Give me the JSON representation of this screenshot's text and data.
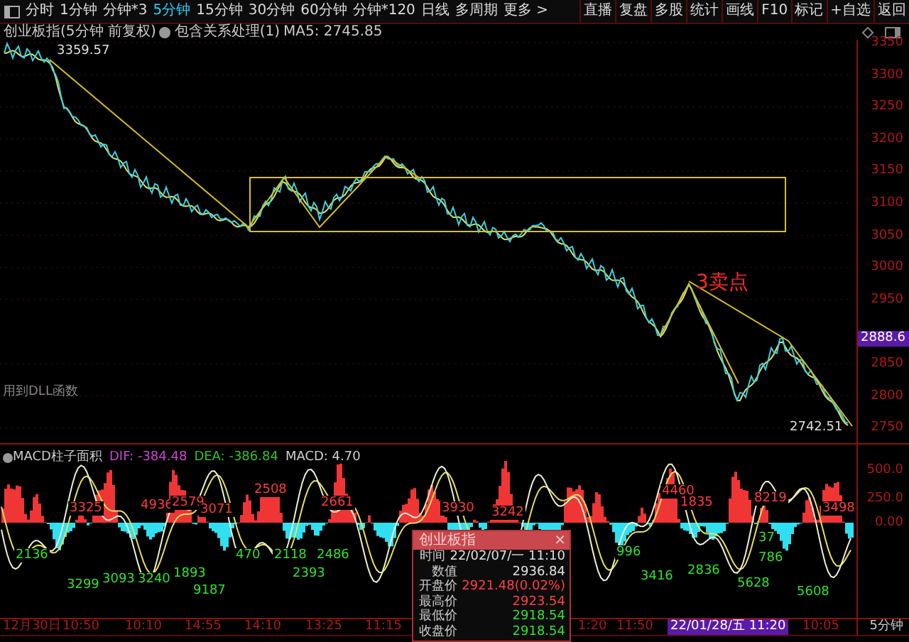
{
  "toolbar": {
    "periods": [
      {
        "label": "分时",
        "selected": false
      },
      {
        "label": "1分钟",
        "selected": false
      },
      {
        "label": "分钟*3",
        "selected": false
      },
      {
        "label": "5分钟",
        "selected": true
      },
      {
        "label": "15分钟",
        "selected": false
      },
      {
        "label": "30分钟",
        "selected": false
      },
      {
        "label": "60分钟",
        "selected": false
      },
      {
        "label": "分钟*120",
        "selected": false
      },
      {
        "label": "日线",
        "selected": false
      },
      {
        "label": "多周期",
        "selected": false
      }
    ],
    "more": "更多 >",
    "actions": [
      "直播",
      "复盘",
      "多股",
      "统计",
      "画线",
      "F10",
      "标记",
      "+自选",
      "返回"
    ]
  },
  "chart_header": {
    "title": "创业板指(5分钟 前复权)",
    "indicator": "包含关系处理(1)",
    "ma": "MA5: 2745.85"
  },
  "price_chart": {
    "high_label": "3359.57",
    "low_label": "2742.51",
    "annotation": "3卖点",
    "footnote": "用到DLL函数",
    "y_axis": [
      "3350",
      "3300",
      "3250",
      "3200",
      "3150",
      "3100",
      "3050",
      "3000",
      "2950",
      "2850",
      "2800",
      "2750"
    ],
    "current_price": "2888.6"
  },
  "macd": {
    "title": "MACD柱子面积",
    "values": [
      {
        "label": "DIF: -384.48",
        "color": "#d040d0"
      },
      {
        "label": "DEA: -386.84",
        "color": "#30c030"
      },
      {
        "label": "MACD: 4.70",
        "color": "#d0d0d0"
      }
    ],
    "y_axis": [
      "500.0",
      "250.0",
      "0.00"
    ],
    "bar_labels": [
      {
        "text": "3325",
        "kind": "positive"
      },
      {
        "text": "4936",
        "kind": "positive"
      },
      {
        "text": "2579",
        "kind": "positive"
      },
      {
        "text": "3071",
        "kind": "positive"
      },
      {
        "text": "2508",
        "kind": "positive"
      },
      {
        "text": "2661",
        "kind": "positive"
      },
      {
        "text": "3930",
        "kind": "positive"
      },
      {
        "text": "3242",
        "kind": "positive"
      },
      {
        "text": "4460",
        "kind": "positive"
      },
      {
        "text": "1835",
        "kind": "positive"
      },
      {
        "text": "8219",
        "kind": "positive"
      },
      {
        "text": "3498",
        "kind": "positive"
      },
      {
        "text": "2136",
        "kind": "negative"
      },
      {
        "text": "3299",
        "kind": "negative"
      },
      {
        "text": "3093",
        "kind": "negative"
      },
      {
        "text": "3240",
        "kind": "negative"
      },
      {
        "text": "1893",
        "kind": "negative"
      },
      {
        "text": "9187",
        "kind": "negative"
      },
      {
        "text": "470",
        "kind": "negative"
      },
      {
        "text": "2118",
        "kind": "negative"
      },
      {
        "text": "2393",
        "kind": "negative"
      },
      {
        "text": "2486",
        "kind": "negative"
      },
      {
        "text": "996",
        "kind": "negative"
      },
      {
        "text": "3416",
        "kind": "negative"
      },
      {
        "text": "2836",
        "kind": "negative"
      },
      {
        "text": "37",
        "kind": "negative"
      },
      {
        "text": "786",
        "kind": "negative"
      },
      {
        "text": "5628",
        "kind": "negative"
      },
      {
        "text": "5608",
        "kind": "negative"
      }
    ]
  },
  "time_axis": {
    "labels": [
      "12月30日",
      "10:50",
      "10:10",
      "14:55",
      "14:10",
      "13:25",
      "11:15",
      "1:20",
      "11:50",
      "10:05"
    ],
    "cursor_time": "22/01/28/五 11:20",
    "period": "5分钟"
  },
  "popup": {
    "title": "创业板指",
    "close": "×",
    "rows": [
      {
        "label": "时间",
        "value": "22/02/07/一 11:10",
        "kind": "neutral"
      },
      {
        "label": "数值",
        "value": "2936.84",
        "kind": "neutral"
      },
      {
        "label": "开盘价",
        "value": "2921.48(0.02%)",
        "kind": "up"
      },
      {
        "label": "最高价",
        "value": "2923.54",
        "kind": "up"
      },
      {
        "label": "最低价",
        "value": "2918.54",
        "kind": "down"
      },
      {
        "label": "收盘价",
        "value": "2918.54",
        "kind": "down"
      }
    ]
  }
}
